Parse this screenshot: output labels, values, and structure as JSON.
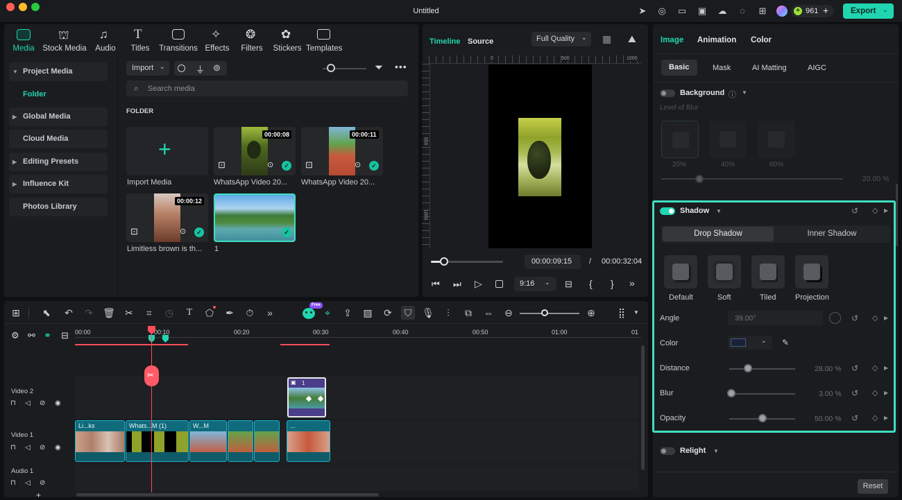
{
  "window": {
    "title": "Untitled"
  },
  "header": {
    "credits": "961",
    "export_label": "Export"
  },
  "library_tabs": [
    {
      "label": "Media",
      "icon": "media-icon",
      "active": true
    },
    {
      "label": "Stock Media",
      "icon": "stock-media-icon"
    },
    {
      "label": "Audio",
      "icon": "audio-icon"
    },
    {
      "label": "Titles",
      "icon": "titles-icon"
    },
    {
      "label": "Transitions",
      "icon": "transitions-icon"
    },
    {
      "label": "Effects",
      "icon": "effects-icon"
    },
    {
      "label": "Filters",
      "icon": "filters-icon"
    },
    {
      "label": "Stickers",
      "icon": "stickers-icon"
    },
    {
      "label": "Templates",
      "icon": "templates-icon"
    }
  ],
  "sidebar": {
    "project_media": "Project Media",
    "folder": "Folder",
    "global_media": "Global Media",
    "cloud_media": "Cloud Media",
    "editing_presets": "Editing Presets",
    "influence_kit": "Influence Kit",
    "photos_library": "Photos Library"
  },
  "media_toolbar": {
    "import_label": "Import",
    "search_placeholder": "Search media",
    "folder_heading": "FOLDER"
  },
  "media_items": [
    {
      "label": "Import Media"
    },
    {
      "label": "WhatsApp Video 20...",
      "duration": "00:00:08"
    },
    {
      "label": "WhatsApp Video 20...",
      "duration": "00:00:11"
    },
    {
      "label": "Limitless brown is th...",
      "duration": "00:00:12"
    },
    {
      "label": "1"
    }
  ],
  "preview": {
    "tab_timeline": "Timeline",
    "tab_source": "Source",
    "quality": "Full Quality",
    "ruler_marks": [
      "0",
      "500",
      "1000"
    ],
    "vruler_marks": [
      "500",
      "1000"
    ],
    "current_time": "00:00:09:15",
    "separator": "/",
    "total_time": "00:00:32:04",
    "aspect": "9:16",
    "progress": 0.18
  },
  "timeline": {
    "ruler": [
      "00:00",
      "00:10",
      "00:20",
      "00:30",
      "00:40",
      "00:50",
      "01:00",
      "01"
    ],
    "badge": "Free",
    "tracks": [
      "Video 2",
      "Video 1",
      "Audio 1"
    ],
    "clip_v2_label": "1",
    "clips_v1": [
      "Li...ks",
      "Whats...M (1)",
      "W...M",
      "",
      "",
      "..."
    ]
  },
  "right_panel": {
    "tabs": [
      "Image",
      "Animation",
      "Color"
    ],
    "subtabs": [
      "Basic",
      "Mask",
      "AI Matting",
      "AIGC"
    ],
    "background": {
      "label": "Background",
      "level_of_blur": "Level of Blur",
      "presets": [
        "20%",
        "40%",
        "60%"
      ],
      "value": "20.00",
      "unit": "%"
    },
    "shadow": {
      "label": "Shadow",
      "types": [
        "Drop Shadow",
        "Inner Shadow"
      ],
      "presets": [
        "Default",
        "Soft",
        "Tiled",
        "Projection"
      ],
      "angle_label": "Angle",
      "angle_value": "39.00°",
      "color_label": "Color",
      "distance_label": "Distance",
      "distance_value": "28.00",
      "distance_level": 0.28,
      "blur_label": "Blur",
      "blur_value": "3.00",
      "blur_level": 0.03,
      "opacity_label": "Opacity",
      "opacity_value": "50.00",
      "opacity_level": 0.5,
      "unit": "%"
    },
    "relight": {
      "label": "Relight"
    },
    "reset_label": "Reset"
  },
  "colors": {
    "accent": "#17c3a0",
    "playhead": "#ff4d5a",
    "clip": "#1690a6",
    "highlight_border": "#3ee0c0"
  }
}
